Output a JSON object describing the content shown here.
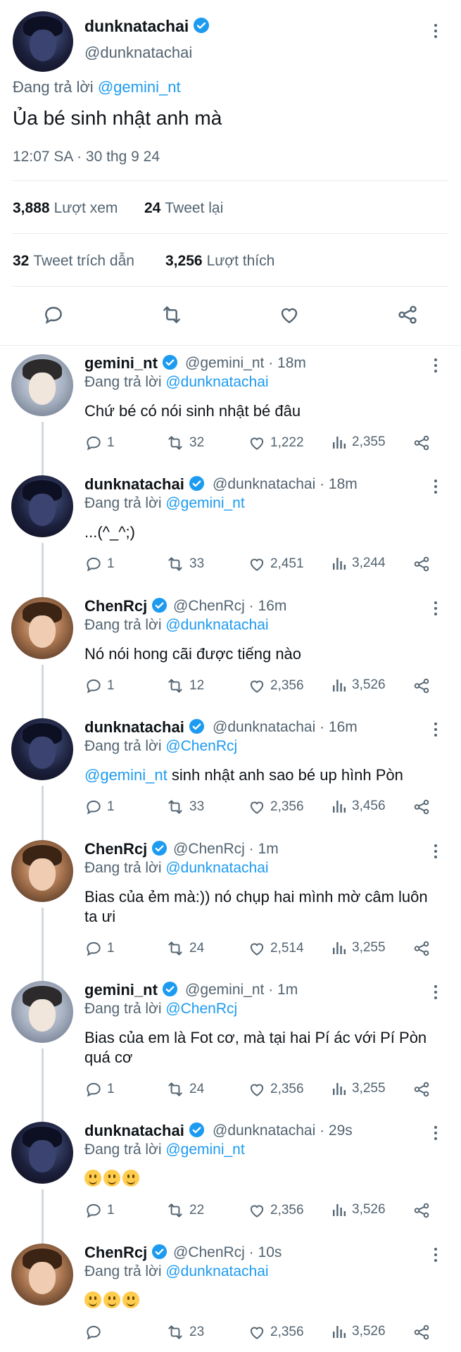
{
  "main_tweet": {
    "name": "dunknatachai",
    "handle": "@dunknatachai",
    "replying_prefix": "Đang trả lời",
    "replying_to": "@gemini_nt",
    "text": "Ủa bé sinh nhật anh mà",
    "timestamp": "12:07 SA · 30 thg 9 24",
    "views_count": "3,888",
    "views_label": "Lượt xem",
    "retweets_count": "24",
    "retweets_label": "Tweet lại",
    "quotes_count": "32",
    "quotes_label": "Tweet trích dẫn",
    "likes_count": "3,256",
    "likes_label": "Lượt thích"
  },
  "replies": [
    {
      "name": "gemini_nt",
      "handle": "@gemini_nt · 18m",
      "replying_prefix": "Đang trả lời",
      "replying_to": "@dunknatachai",
      "text": "Chứ bé có nói sinh nhật bé đâu",
      "replies": "1",
      "retweets": "32",
      "likes": "1,222",
      "views": "2,355"
    },
    {
      "name": "dunknatachai",
      "handle": "@dunknatachai · 18m",
      "replying_prefix": "Đang trả lời",
      "replying_to": "@gemini_nt",
      "text": "...(^_^;)",
      "replies": "1",
      "retweets": "33",
      "likes": "2,451",
      "views": "3,244"
    },
    {
      "name": "ChenRcj",
      "handle": "@ChenRcj · 16m",
      "replying_prefix": "Đang trả lời",
      "replying_to": "@dunknatachai",
      "text": "Nó nói hong cãi được tiếng nào",
      "replies": "1",
      "retweets": "12",
      "likes": "2,356",
      "views": "3,526"
    },
    {
      "name": "dunknatachai",
      "handle": "@dunknatachai · 16m",
      "replying_prefix": "Đang trả lời",
      "replying_to": "@ChenRcj",
      "text_mention": "@gemini_nt",
      "text": " sinh nhật anh sao bé up hình Pòn",
      "replies": "1",
      "retweets": "33",
      "likes": "2,356",
      "views": "3,456"
    },
    {
      "name": "ChenRcj",
      "handle": "@ChenRcj · 1m",
      "replying_prefix": "Đang trả lời",
      "replying_to": "@dunknatachai",
      "text": "Bias của ẻm mà:)) nó chụp hai mình mờ câm luôn ta ưi",
      "replies": "1",
      "retweets": "24",
      "likes": "2,514",
      "views": "3,255"
    },
    {
      "name": "gemini_nt",
      "handle": "@gemini_nt · 1m",
      "replying_prefix": "Đang trả lời",
      "replying_to": "@ChenRcj",
      "text": "Bias của em là Fot cơ, mà tại hai Pí ác với Pí Pòn quá cơ",
      "replies": "1",
      "retweets": "24",
      "likes": "2,356",
      "views": "3,255"
    },
    {
      "name": "dunknatachai",
      "handle": "@dunknatachai · 29s",
      "replying_prefix": "Đang trả lời",
      "replying_to": "@gemini_nt",
      "replies": "1",
      "retweets": "22",
      "likes": "2,356",
      "views": "3,526"
    },
    {
      "name": "ChenRcj",
      "handle": "@ChenRcj · 10s",
      "replying_prefix": "Đang trả lời",
      "replying_to": "@dunknatachai",
      "replies": "",
      "retweets": "23",
      "likes": "2,356",
      "views": "3,526"
    }
  ]
}
